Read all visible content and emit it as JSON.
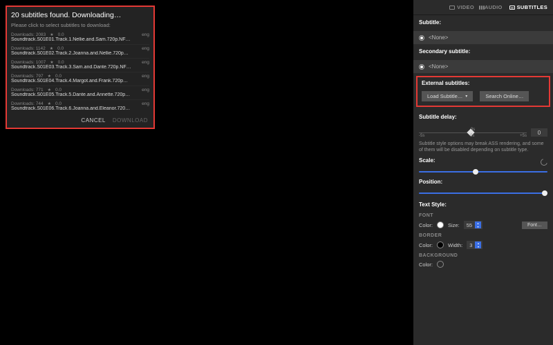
{
  "modal": {
    "title": "20 subtitles found. Downloading…",
    "subtitle": "Please click to select subtitles to download:",
    "downloads_prefix": "Downloads:",
    "lang": "eng",
    "items": [
      {
        "dl": "2083",
        "rating": "0.0",
        "file": "Soundtrack.S01E01.Track.1.Nellie.and.Sam.720p.NF…"
      },
      {
        "dl": "1142",
        "rating": "0.0",
        "file": "Soundtrack.S01E02.Track.2.Joanna.and.Nellie.720p…"
      },
      {
        "dl": "1007",
        "rating": "0.0",
        "file": "Soundtrack.S01E03.Track.3.Sam.and.Dante.720p.NF…"
      },
      {
        "dl": "797",
        "rating": "0.0",
        "file": "Soundtrack.S01E04.Track.4.Margot.and.Frank.720p…"
      },
      {
        "dl": "771",
        "rating": "0.0",
        "file": "Soundtrack.S01E05.Track.5.Dante.and.Annette.720p…"
      },
      {
        "dl": "744",
        "rating": "0.0",
        "file": "Soundtrack.S01E06.Track.6.Joanna.and.Eleanor.720…"
      }
    ],
    "cancel": "CANCEL",
    "download": "DOWNLOAD"
  },
  "tabs": {
    "video": "VIDEO",
    "audio": "AUDIO",
    "subtitles": "SUBTITLES"
  },
  "sub": {
    "primary_label": "Subtitle:",
    "secondary_label": "Secondary subtitle:",
    "none": "<None>",
    "external_label": "External subtitles:",
    "load_btn": "Load Subtitle…",
    "search_btn": "Search Online…",
    "delay_label": "Subtitle delay:",
    "delay_min": "-5s",
    "delay_center": "0s",
    "delay_center_top": "0s",
    "delay_max": "+5s",
    "delay_value": "0",
    "note": "Subtitle style options may break ASS rendering, and some of them will be disabled depending on subtitle type.",
    "scale_label": "Scale:",
    "position_label": "Position:",
    "textstyle_label": "Text Style:",
    "font_cat": "FONT",
    "border_cat": "BORDER",
    "background_cat": "BACKGROUND",
    "color_lbl": "Color:",
    "size_lbl": "Size:",
    "width_lbl": "Width:",
    "font_size": "55",
    "border_width": "3",
    "font_btn": "Font…"
  }
}
